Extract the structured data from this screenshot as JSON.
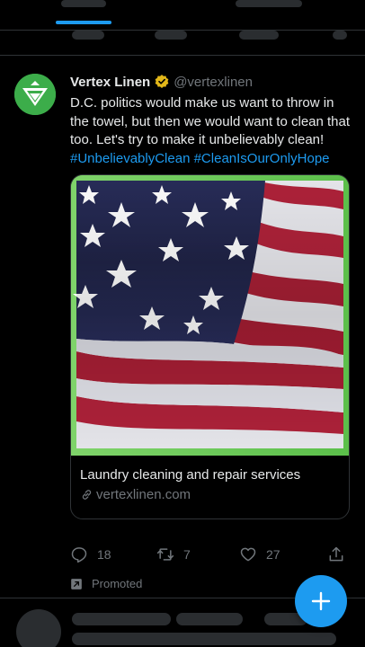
{
  "tweet": {
    "display_name": "Vertex Linen",
    "handle": "@vertexlinen",
    "text": "D.C. politics would make us want to throw in the towel, but then we would want to clean that too. Let's try to make it unbelievably clean!",
    "hashtags": [
      "#UnbelievablyClean",
      "#CleanIsOurOnlyHope"
    ],
    "card": {
      "title": "Laundry cleaning and repair services",
      "domain": "vertexlinen.com",
      "image_icon": "american-flag"
    },
    "stats": {
      "replies": "18",
      "retweets": "7",
      "likes": "27"
    },
    "promoted_label": "Promoted"
  },
  "icons": {
    "verified": "verified-badge-icon",
    "reply": "reply-icon",
    "retweet": "retweet-icon",
    "like": "heart-icon",
    "share": "share-icon",
    "promoted": "promoted-icon",
    "link": "link-icon",
    "compose": "plus-icon"
  },
  "colors": {
    "accent": "#1d9bf0",
    "brand_green": "#3cad4a",
    "verified_gold": "#e2b719",
    "muted_text": "#71767b"
  }
}
